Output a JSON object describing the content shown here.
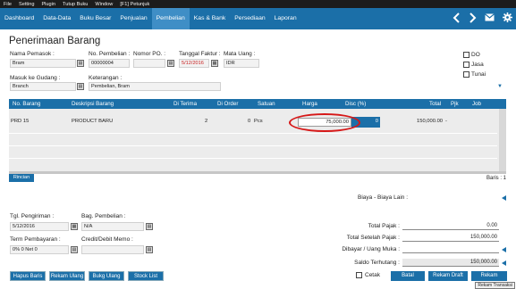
{
  "menubar": {
    "items": [
      "File",
      "Setting",
      "Plugin",
      "Tutup Buku",
      "Window",
      "[F1] Petunjuk"
    ]
  },
  "navbar": {
    "tabs": [
      "Dashboard",
      "Data-Data",
      "Buku Besar",
      "Penjualan",
      "Pembelian",
      "Kas & Bank",
      "Persediaan",
      "Laporan"
    ],
    "active_tab": "Pembelian",
    "icons": [
      "chevron-left-icon",
      "chevron-right-icon",
      "mail-icon",
      "gear-icon"
    ]
  },
  "page": {
    "title": "Penerimaan Barang"
  },
  "form": {
    "nama_pemasok": {
      "label": "Nama Pemasok :",
      "value": "Bram"
    },
    "no_pembelian": {
      "label": "No. Pembelian :",
      "value": "00000004"
    },
    "nomor_po": {
      "label": "Nomor PO. :",
      "value": ""
    },
    "tanggal_faktur": {
      "label": "Tanggal Faktur :",
      "value": "5/12/2016",
      "color": "#c81e1e"
    },
    "mata_uang": {
      "label": "Mata Uang :",
      "value": "IDR"
    },
    "masuk_ke_gudang": {
      "label": "Masuk ke Gudang :",
      "value": "Branch"
    },
    "keterangan": {
      "label": "Keterangan :",
      "value": "Pembelian, Bram"
    },
    "checkboxes": [
      {
        "label": "DO",
        "checked": false
      },
      {
        "label": "Jasa",
        "checked": false
      },
      {
        "label": "Tunai",
        "checked": false
      }
    ]
  },
  "grid": {
    "headers": [
      "No. Barang",
      "Deskripsi Barang",
      "Di Terima",
      "Di Order",
      "Satuan",
      "Harga",
      "Disc (%)",
      "Total",
      "Pjk",
      "Job"
    ],
    "rows": [
      {
        "no_barang": "PRD 15",
        "deskripsi": "PRODUCT BARU",
        "di_terima": "2",
        "di_order": "0",
        "satuan": "Pcs",
        "harga": "75,000.00",
        "disc": "0",
        "total": "150,000.00",
        "pjk": "-",
        "job": ""
      }
    ],
    "rincian_label": "Rincian",
    "baris": "Baris : 1"
  },
  "bottom_left": {
    "tgl_pengiriman": {
      "label": "Tgl. Pengiriman :",
      "value": "5/12/2016"
    },
    "bag_pembelian": {
      "label": "Bag. Pembelian :",
      "value": "N/A"
    },
    "term_pembayaran": {
      "label": "Term Pembayaran :",
      "value": "0% 0 Net 0"
    },
    "credit_debit_memo": {
      "label": "Credit/Debit Memo :",
      "value": ""
    }
  },
  "totals": {
    "biaya_lain": {
      "label": "Biaya - Biaya Lain :",
      "value": ""
    },
    "total_pajak": {
      "label": "Total Pajak :",
      "value": "0.00"
    },
    "total_setelah_pajak": {
      "label": "Total Setelah Pajak :",
      "value": "150,000.00"
    },
    "dibayar_uang_muka": {
      "label": "Dibayar / Uang Muka :",
      "value": ""
    },
    "saldo_terhutang": {
      "label": "Saldo Terhutang :",
      "value": "150,000.00"
    }
  },
  "buttons": {
    "hapus_baris": "Hapus Baris",
    "rekam_ulang": "Rekam Ulang",
    "bukg_ulang": "Bukg Ulang",
    "stock_list": "Stock List",
    "cetak": "Cetak",
    "batal": "Batal",
    "rekam_draft": "Rekam Draft",
    "rekam": "Rekam"
  },
  "tooltip": "Rekam Transaksi",
  "colors": {
    "accent": "#1b6fa8",
    "active_tab": "#3f8ec6",
    "annotation_ellipse": "#d61818",
    "date_red": "#c81e1e"
  }
}
